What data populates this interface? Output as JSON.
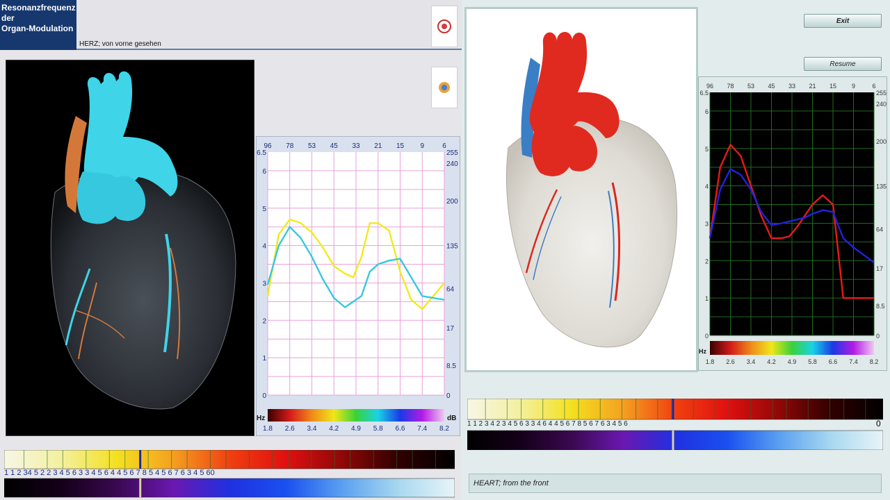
{
  "left_panel": {
    "title_lines": [
      "Resonanzfrequenz",
      "der",
      "Organ-Modulation"
    ],
    "organ_caption": "HERZ;  von vorne gesehen",
    "icons": [
      "record-icon",
      "settings-icon"
    ],
    "image_icon": "heart-anatomy-icon",
    "strip_numbers": "1 1   2     34       5  2   2    3      4    5  6 3   3     4          5     6 4 4 5     6            7 8 5 4   5          6            7 6 3    4       5             60",
    "strip_marker_value": 0.302
  },
  "right_panel": {
    "exit_label": "Exit",
    "resume_label": "Resume",
    "caption": "HEART;  from the front",
    "image_icon": "heart-anatomy-icon",
    "strip_numbers": "1  1    2     3 4      2     3      4   5 6 3     3          4       6  4  4 5   6           7  8 5        6        7 6  3     4       5         6",
    "strip_end_label": "0",
    "strip_marker_value": 0.495
  },
  "chart_data": [
    {
      "type": "line",
      "top_labels": [
        "96",
        "78",
        "53",
        "45",
        "33",
        "21",
        "15",
        "9",
        "6"
      ],
      "left_labels": [
        "6.5",
        "6",
        "5",
        "4",
        "3",
        "2",
        "1",
        "0"
      ],
      "right_labels": [
        "255",
        "240",
        "200",
        "135",
        "64",
        "17",
        "8.5",
        "0"
      ],
      "bottom_labels": [
        "1.8",
        "2.6",
        "3.4",
        "4.2",
        "4.9",
        "5.8",
        "6.6",
        "7.4",
        "8.2"
      ],
      "unit_left": "Hz",
      "unit_right": "dB",
      "ylim": [
        0,
        6.5
      ],
      "series": [
        {
          "color": "#f0ea20",
          "values": [
            [
              1.8,
              2.65
            ],
            [
              2.2,
              4.3
            ],
            [
              2.6,
              4.7
            ],
            [
              3.0,
              4.6
            ],
            [
              3.4,
              4.35
            ],
            [
              3.8,
              3.95
            ],
            [
              4.2,
              3.45
            ],
            [
              4.6,
              3.25
            ],
            [
              4.9,
              3.15
            ],
            [
              5.2,
              3.7
            ],
            [
              5.5,
              4.6
            ],
            [
              5.8,
              4.6
            ],
            [
              6.2,
              4.4
            ],
            [
              6.6,
              3.3
            ],
            [
              7.0,
              2.55
            ],
            [
              7.4,
              2.3
            ],
            [
              7.8,
              2.65
            ],
            [
              8.2,
              3.0
            ]
          ]
        },
        {
          "color": "#35c8e0",
          "values": [
            [
              1.8,
              2.95
            ],
            [
              2.2,
              4.0
            ],
            [
              2.6,
              4.5
            ],
            [
              3.0,
              4.2
            ],
            [
              3.4,
              3.7
            ],
            [
              3.8,
              3.1
            ],
            [
              4.2,
              2.6
            ],
            [
              4.6,
              2.35
            ],
            [
              4.9,
              2.5
            ],
            [
              5.2,
              2.65
            ],
            [
              5.5,
              3.3
            ],
            [
              5.8,
              3.5
            ],
            [
              6.2,
              3.6
            ],
            [
              6.6,
              3.65
            ],
            [
              7.0,
              3.15
            ],
            [
              7.4,
              2.65
            ],
            [
              7.8,
              2.6
            ],
            [
              8.2,
              2.55
            ]
          ]
        }
      ]
    },
    {
      "type": "line",
      "top_labels": [
        "96",
        "78",
        "53",
        "45",
        "33",
        "21",
        "15",
        "9",
        "6"
      ],
      "left_labels": [
        "6.5",
        "6",
        "5",
        "4",
        "3",
        "2",
        "1",
        "0"
      ],
      "right_labels": [
        "255",
        "240",
        "200",
        "135",
        "64",
        "17",
        "8.5",
        "0"
      ],
      "bottom_labels": [
        "1.8",
        "2.6",
        "3.4",
        "4.2",
        "4.9",
        "5.8",
        "6.6",
        "7.4",
        "8.2"
      ],
      "unit_left": "Hz",
      "ylim": [
        0,
        6.5
      ],
      "series": [
        {
          "color": "#e81a1a",
          "values": [
            [
              1.8,
              2.6
            ],
            [
              2.2,
              4.5
            ],
            [
              2.6,
              5.1
            ],
            [
              3.0,
              4.8
            ],
            [
              3.4,
              4.0
            ],
            [
              3.8,
              3.2
            ],
            [
              4.2,
              2.6
            ],
            [
              4.6,
              2.6
            ],
            [
              4.9,
              2.65
            ],
            [
              5.2,
              2.9
            ],
            [
              5.5,
              3.2
            ],
            [
              5.8,
              3.5
            ],
            [
              6.2,
              3.75
            ],
            [
              6.6,
              3.5
            ],
            [
              7.0,
              1.0
            ],
            [
              7.4,
              1.0
            ],
            [
              7.8,
              1.0
            ],
            [
              8.2,
              1.0
            ]
          ]
        },
        {
          "color": "#2222e0",
          "values": [
            [
              1.8,
              2.6
            ],
            [
              2.2,
              3.9
            ],
            [
              2.6,
              4.45
            ],
            [
              3.0,
              4.3
            ],
            [
              3.4,
              3.9
            ],
            [
              3.8,
              3.3
            ],
            [
              4.2,
              2.95
            ],
            [
              4.6,
              3.0
            ],
            [
              4.9,
              3.05
            ],
            [
              5.2,
              3.1
            ],
            [
              5.5,
              3.15
            ],
            [
              5.8,
              3.25
            ],
            [
              6.2,
              3.35
            ],
            [
              6.6,
              3.3
            ],
            [
              7.0,
              2.6
            ],
            [
              7.4,
              2.35
            ],
            [
              7.8,
              2.15
            ],
            [
              8.2,
              1.95
            ]
          ]
        }
      ]
    }
  ],
  "colors": {
    "title_bg": "#16386f",
    "left_chart_bg": "#ffffff",
    "right_chart_bg": "#000000",
    "grid_left": "#e8a0d8",
    "grid_right": "#1f6b1f"
  }
}
